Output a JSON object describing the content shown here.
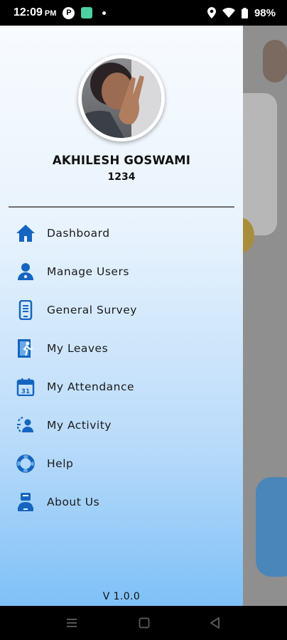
{
  "status_bar": {
    "time": "12:09",
    "ampm": "PM",
    "p_icon_letter": "P",
    "battery": "98%",
    "icons": [
      "p-app-icon",
      "notification-app-icon",
      "dot-icon",
      "location-icon",
      "wifi-icon",
      "battery-icon"
    ]
  },
  "drawer": {
    "user": {
      "name": "AKHILESH GOSWAMI",
      "id": "1234"
    },
    "menu": [
      {
        "label": "Dashboard",
        "icon": "home-icon"
      },
      {
        "label": "Manage Users",
        "icon": "user-icon"
      },
      {
        "label": "General Survey",
        "icon": "survey-phone-icon"
      },
      {
        "label": "My Leaves",
        "icon": "leave-exit-icon"
      },
      {
        "label": "My Attendance",
        "icon": "calendar-icon"
      },
      {
        "label": "My Activity",
        "icon": "activity-icon"
      },
      {
        "label": "Help",
        "icon": "lifebuoy-icon"
      },
      {
        "label": "About Us",
        "icon": "about-person-icon"
      }
    ],
    "version": "V 1.0.0"
  },
  "colors": {
    "accent": "#1565c0",
    "drawer_top": "#f8fbfe",
    "drawer_bottom": "#7ec0f7"
  }
}
